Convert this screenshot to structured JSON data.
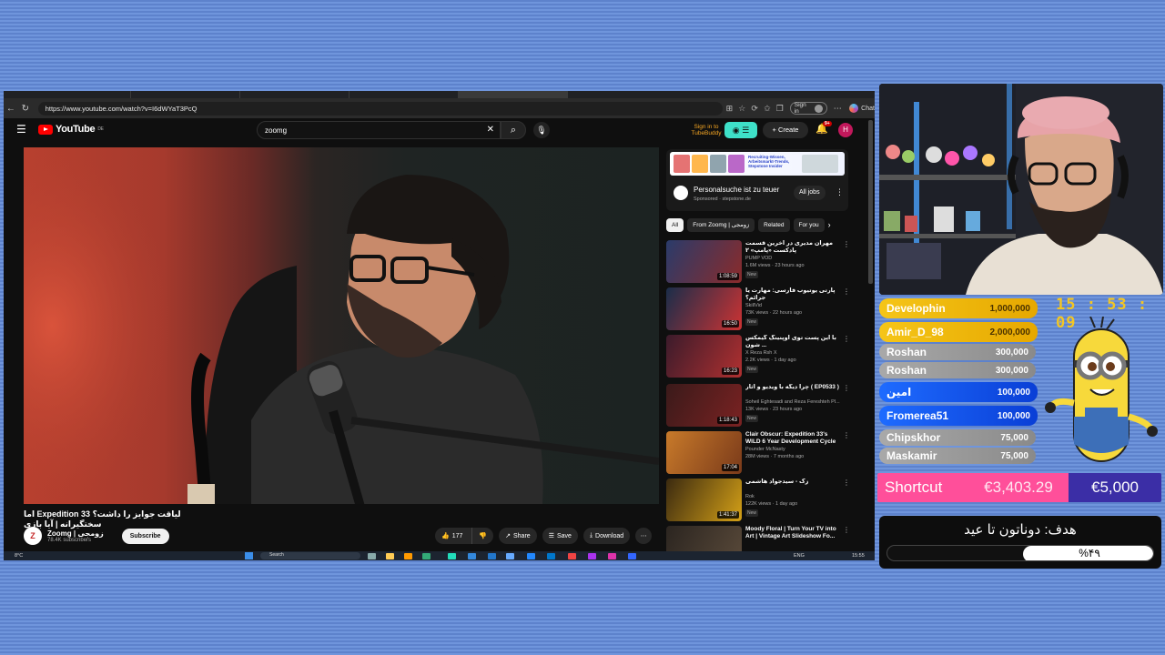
{
  "browser": {
    "url": "https://www.youtube.com/watch?v=I6dWYaT3PcQ",
    "signin": "Sign in",
    "chat": "Chat"
  },
  "youtube": {
    "logo": "YouTube",
    "region": "DE",
    "search_value": "zoomg",
    "zubebuddy": "Sign in to TubeBuddy",
    "create": "Create",
    "notif_count": "9+",
    "avatar_letter": "H"
  },
  "video": {
    "title": "لیاقت جوایز را داشت؟ Expedition 33 اما سختگیرانه | آیا بازی",
    "channel": "Zoomg | زومجی",
    "channel_initial": "Z",
    "subscribers": "78.4K subscribers",
    "subscribe": "Subscribe",
    "likes": "177",
    "share": "Share",
    "save": "Save",
    "download": "Download"
  },
  "ad": {
    "banner_text": "Recruiting-Wissen, Arbeitsmarkt-Trends, Stepstone Insider",
    "title": "Personalsuche ist zu teuer",
    "sponsored": "Sponsored · stepstone.de",
    "button": "All jobs"
  },
  "chips": [
    "All",
    "From Zoomg | زومجی",
    "Related",
    "For you"
  ],
  "recs": [
    {
      "title": "مهران مدیری در آخرین قسمت پادکست «پامپ» ۲",
      "channel": "PUMP VOD",
      "meta": "1.6M views · 23 hours ago",
      "dur": "1:08:59",
      "new": "New",
      "c1": "#2a3b6a",
      "c2": "#8a2b2b"
    },
    {
      "title": "پارتی یوتیوب فارسی: مهارت یا جرائم؟",
      "channel": "SkillVid",
      "meta": "73K views · 22 hours ago",
      "dur": "16:50",
      "new": "New",
      "c1": "#1a2d4a",
      "c2": "#cc3333"
    },
    {
      "title": "با این پست توی اوپنینگ گیمکس شون ...",
      "channel": "X Reza Rsh X",
      "meta": "2.2K views · 1 day ago",
      "dur": "16:23",
      "new": "New",
      "c1": "#3b1b2b",
      "c2": "#b03030"
    },
    {
      "title": "چرا دیگه با ویدیو و آثار ( EP0533 )",
      "channel": "Soheil Eghtesadi and Reza Fereshteh Pl...",
      "meta": "13K views · 23 hours ago",
      "dur": "1:18:43",
      "new": "New",
      "c1": "#3a1a1a",
      "c2": "#7a2222"
    },
    {
      "title": "Clair Obscur: Expedition 33's WILD 6 Year Development Cycle",
      "channel": "Pounder McNasty",
      "meta": "28M views · 7 months ago",
      "dur": "17:04",
      "new": "",
      "c1": "#c87a2a",
      "c2": "#7a3a1a"
    },
    {
      "title": "زک - سیدجواد هاشمی",
      "channel": "Rok",
      "meta": "122K views · 1 day ago",
      "dur": "1:41:37",
      "new": "New",
      "c1": "#3b2a10",
      "c2": "#d4a017"
    },
    {
      "title": "Moody Floral | Turn Your TV into Art | Vintage Art Slideshow Fo...",
      "channel": "",
      "meta": "",
      "dur": "",
      "new": "",
      "c1": "#2b2520",
      "c2": "#5a4a3a"
    }
  ],
  "taskbar": {
    "weather": "8°C",
    "search": "Search",
    "lang": "ENG",
    "time": "15:55"
  },
  "overlay": {
    "clock": "15 : 53 : 09",
    "donors": [
      {
        "name": "Develophin",
        "amount": "1,000,000",
        "tier": "gold"
      },
      {
        "name": "Amir_D_98",
        "amount": "2,000,000",
        "tier": "gold"
      },
      {
        "name": "Roshan",
        "amount": "300,000",
        "tier": "grey"
      },
      {
        "name": "Roshan",
        "amount": "300,000",
        "tier": "grey"
      },
      {
        "name": "امین",
        "amount": "100,000",
        "tier": "blue"
      },
      {
        "name": "Fromerea51",
        "amount": "100,000",
        "tier": "blue"
      },
      {
        "name": "Chipskhor",
        "amount": "75,000",
        "tier": "grey"
      },
      {
        "name": "Maskamir",
        "amount": "75,000",
        "tier": "grey"
      }
    ],
    "goal": {
      "name": "Shortcut",
      "current": "€3,403.29",
      "target": "€5,000"
    },
    "ramadan": {
      "title": "هدف: دوناتون تا عید",
      "percent_text": "%۴۹",
      "percent": 49
    }
  }
}
